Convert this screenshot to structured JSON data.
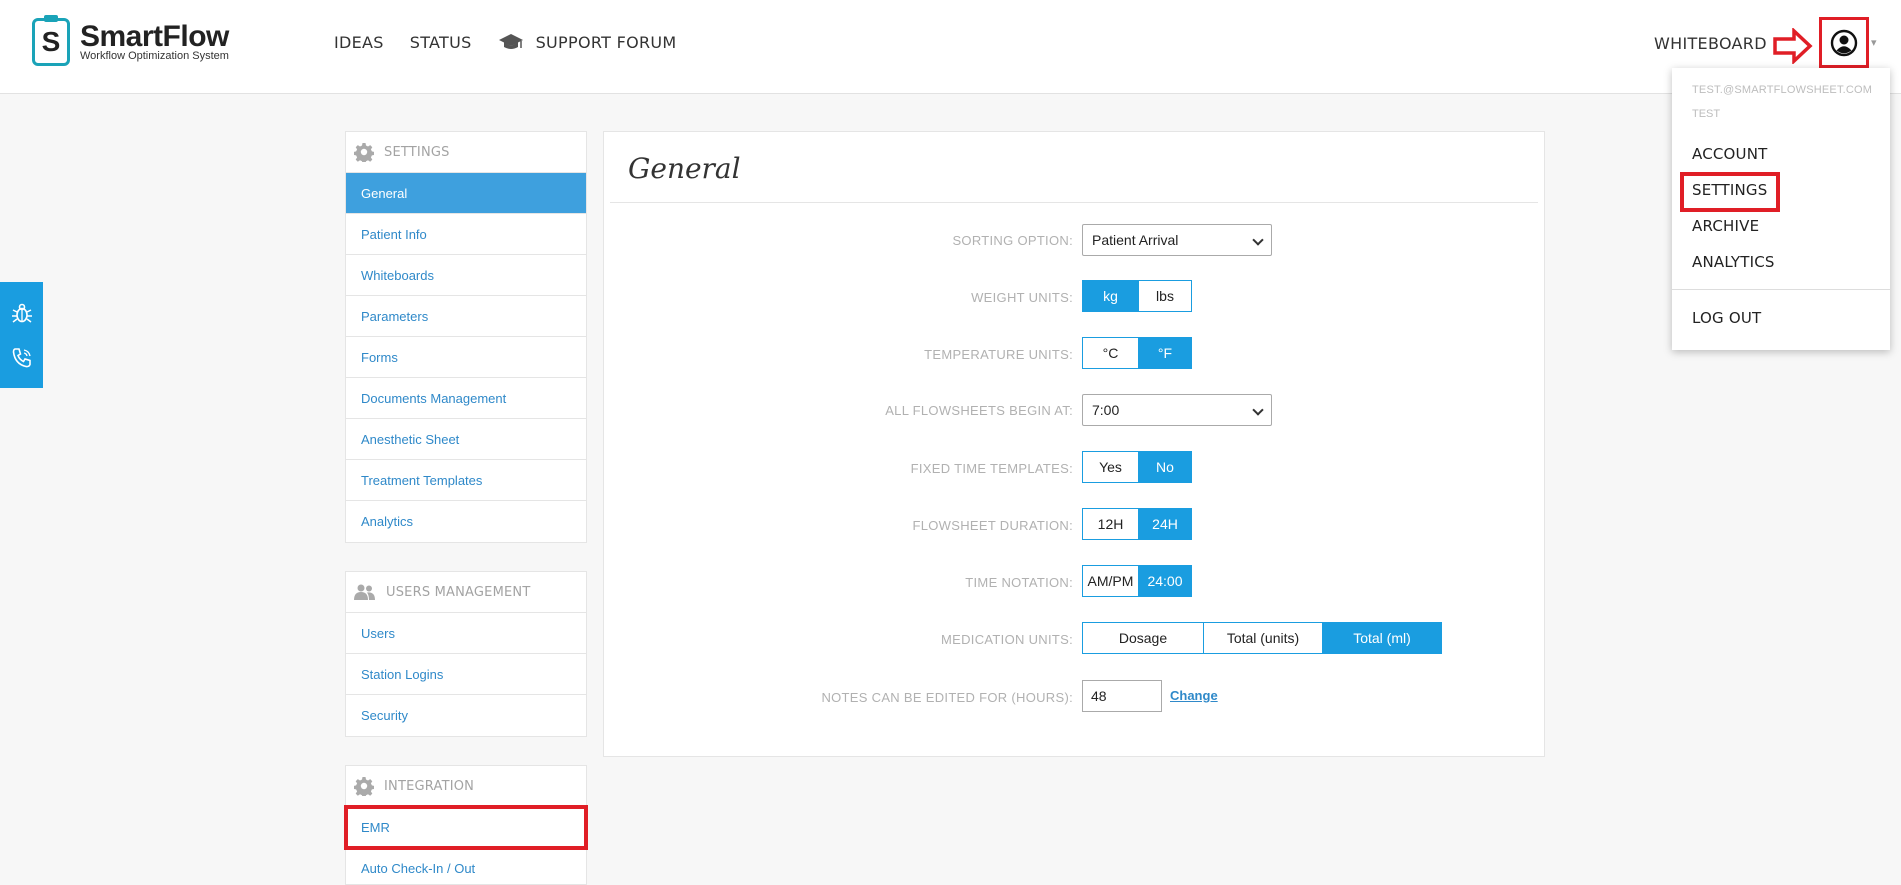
{
  "brand": {
    "name": "SmartFlow",
    "tagline": "Workflow Optimization System",
    "badge_letter": "S",
    "accent": "#1a9de0"
  },
  "nav": {
    "ideas": "IDEAS",
    "status": "STATUS",
    "support": "SUPPORT FORUM",
    "support_icon": "graduation-cap-icon",
    "whiteboard": "WHITEBOARD",
    "user_icon": "user-circle-icon"
  },
  "side_tab": {
    "icons": [
      "bug-icon",
      "phone-icon"
    ]
  },
  "settings_panel": {
    "title": "SETTINGS",
    "items": [
      "General",
      "Patient Info",
      "Whiteboards",
      "Parameters",
      "Forms",
      "Documents Management",
      "Anesthetic Sheet",
      "Treatment Templates",
      "Analytics"
    ],
    "active": "General"
  },
  "users_panel": {
    "title": "USERS MANAGEMENT",
    "items": [
      "Users",
      "Station Logins",
      "Security"
    ]
  },
  "integration_panel": {
    "title": "INTEGRATION",
    "items": [
      "EMR",
      "Auto Check-In / Out"
    ]
  },
  "main": {
    "title": "General",
    "sorting": {
      "label": "SORTING OPTION:",
      "value": "Patient Arrival"
    },
    "weight": {
      "label": "WEIGHT UNITS:",
      "options": [
        "kg",
        "lbs"
      ],
      "selected": "kg"
    },
    "temperature": {
      "label": "TEMPERATURE UNITS:",
      "options": [
        "°C",
        "°F"
      ],
      "selected": "°F"
    },
    "begin": {
      "label": "ALL FLOWSHEETS BEGIN AT:",
      "value": "7:00"
    },
    "fixed": {
      "label": "FIXED TIME TEMPLATES:",
      "options": [
        "Yes",
        "No"
      ],
      "selected": "No"
    },
    "duration": {
      "label": "FLOWSHEET DURATION:",
      "options": [
        "12H",
        "24H"
      ],
      "selected": "24H"
    },
    "notation": {
      "label": "TIME NOTATION:",
      "options": [
        "AM/PM",
        "24:00"
      ],
      "selected": "24:00"
    },
    "medication": {
      "label": "MEDICATION UNITS:",
      "options": [
        "Dosage",
        "Total (units)",
        "Total (ml)"
      ],
      "selected": "Total (ml)"
    },
    "notes": {
      "label": "NOTES CAN BE EDITED FOR (HOURS):",
      "value": "48",
      "link": "Change"
    }
  },
  "user_menu": {
    "email": "TEST.@SMARTFLOWSHEET.COM",
    "username": "TEST",
    "account": "ACCOUNT",
    "settings": "SETTINGS",
    "archive": "ARCHIVE",
    "analytics": "ANALYTICS",
    "logout": "LOG OUT"
  }
}
